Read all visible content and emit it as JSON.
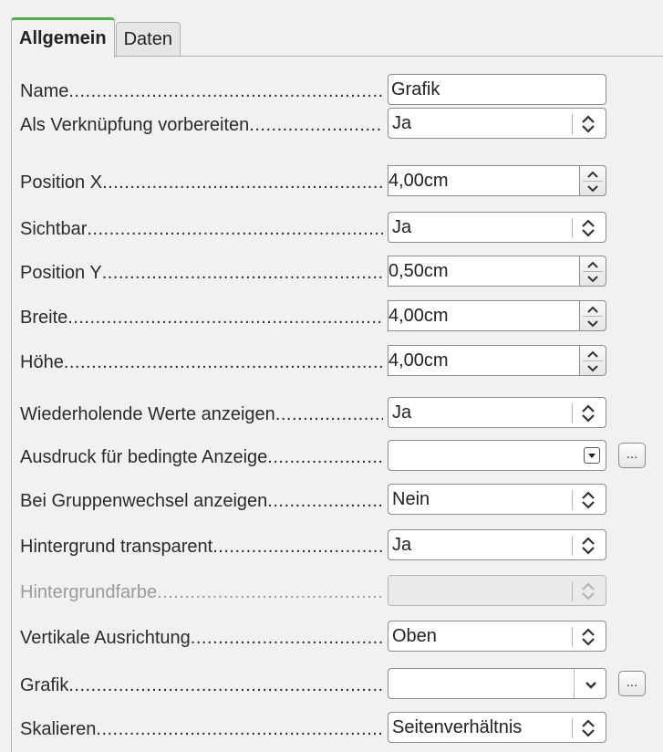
{
  "tabs": [
    {
      "label": "Allgemein",
      "active": true
    },
    {
      "label": "Daten",
      "active": false
    }
  ],
  "accent_color": "#4caf50",
  "properties": {
    "name": {
      "label": "Name",
      "value": "Grafik"
    },
    "link": {
      "label": "Als Verknüpfung vorbereiten",
      "value": "Ja"
    },
    "pos_x": {
      "label": "Position X",
      "value": "4,00cm"
    },
    "visible": {
      "label": "Sichtbar",
      "value": "Ja"
    },
    "pos_y": {
      "label": "Position Y",
      "value": "0,50cm"
    },
    "width": {
      "label": "Breite",
      "value": "4,00cm"
    },
    "height": {
      "label": "Höhe",
      "value": "4,00cm"
    },
    "repeat": {
      "label": "Wiederholende Werte anzeigen",
      "value": "Ja"
    },
    "cond_expr": {
      "label": "Ausdruck für bedingte Anzeige",
      "value": "",
      "button": "..."
    },
    "group_change": {
      "label": "Bei Gruppenwechsel anzeigen",
      "value": "Nein"
    },
    "transparent": {
      "label": "Hintergrund transparent",
      "value": "Ja"
    },
    "bg_color": {
      "label": "Hintergrundfarbe",
      "value": "",
      "disabled": true
    },
    "valign": {
      "label": "Vertikale Ausrichtung",
      "value": "Oben"
    },
    "graphic": {
      "label": "Grafik",
      "value": "",
      "button": "..."
    },
    "scale": {
      "label": "Skalieren",
      "value": "Seitenverhältnis"
    }
  }
}
